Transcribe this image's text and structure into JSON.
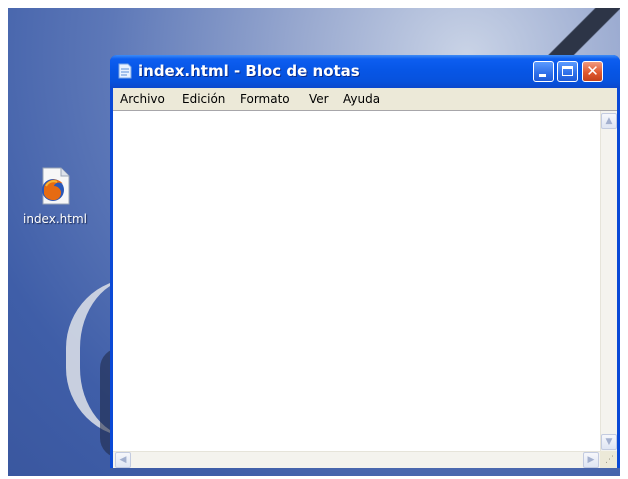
{
  "desktop": {
    "icon_label": "index.html",
    "icon_name": "firefox-html-file-icon"
  },
  "window": {
    "title": "index.html - Bloc de notas",
    "title_icon": "notepad-icon",
    "controls": [
      "minimize-icon",
      "maximize-icon",
      "close-icon"
    ]
  },
  "menu": {
    "items": [
      "Archivo",
      "Edición",
      "Formato",
      "Ver",
      "Ayuda"
    ]
  },
  "editor": {
    "content": ""
  },
  "colors": {
    "titlebar": "#0756e6",
    "close_button": "#e0592f",
    "menubar": "#ece9d8",
    "desktop": "#5d78b8"
  }
}
